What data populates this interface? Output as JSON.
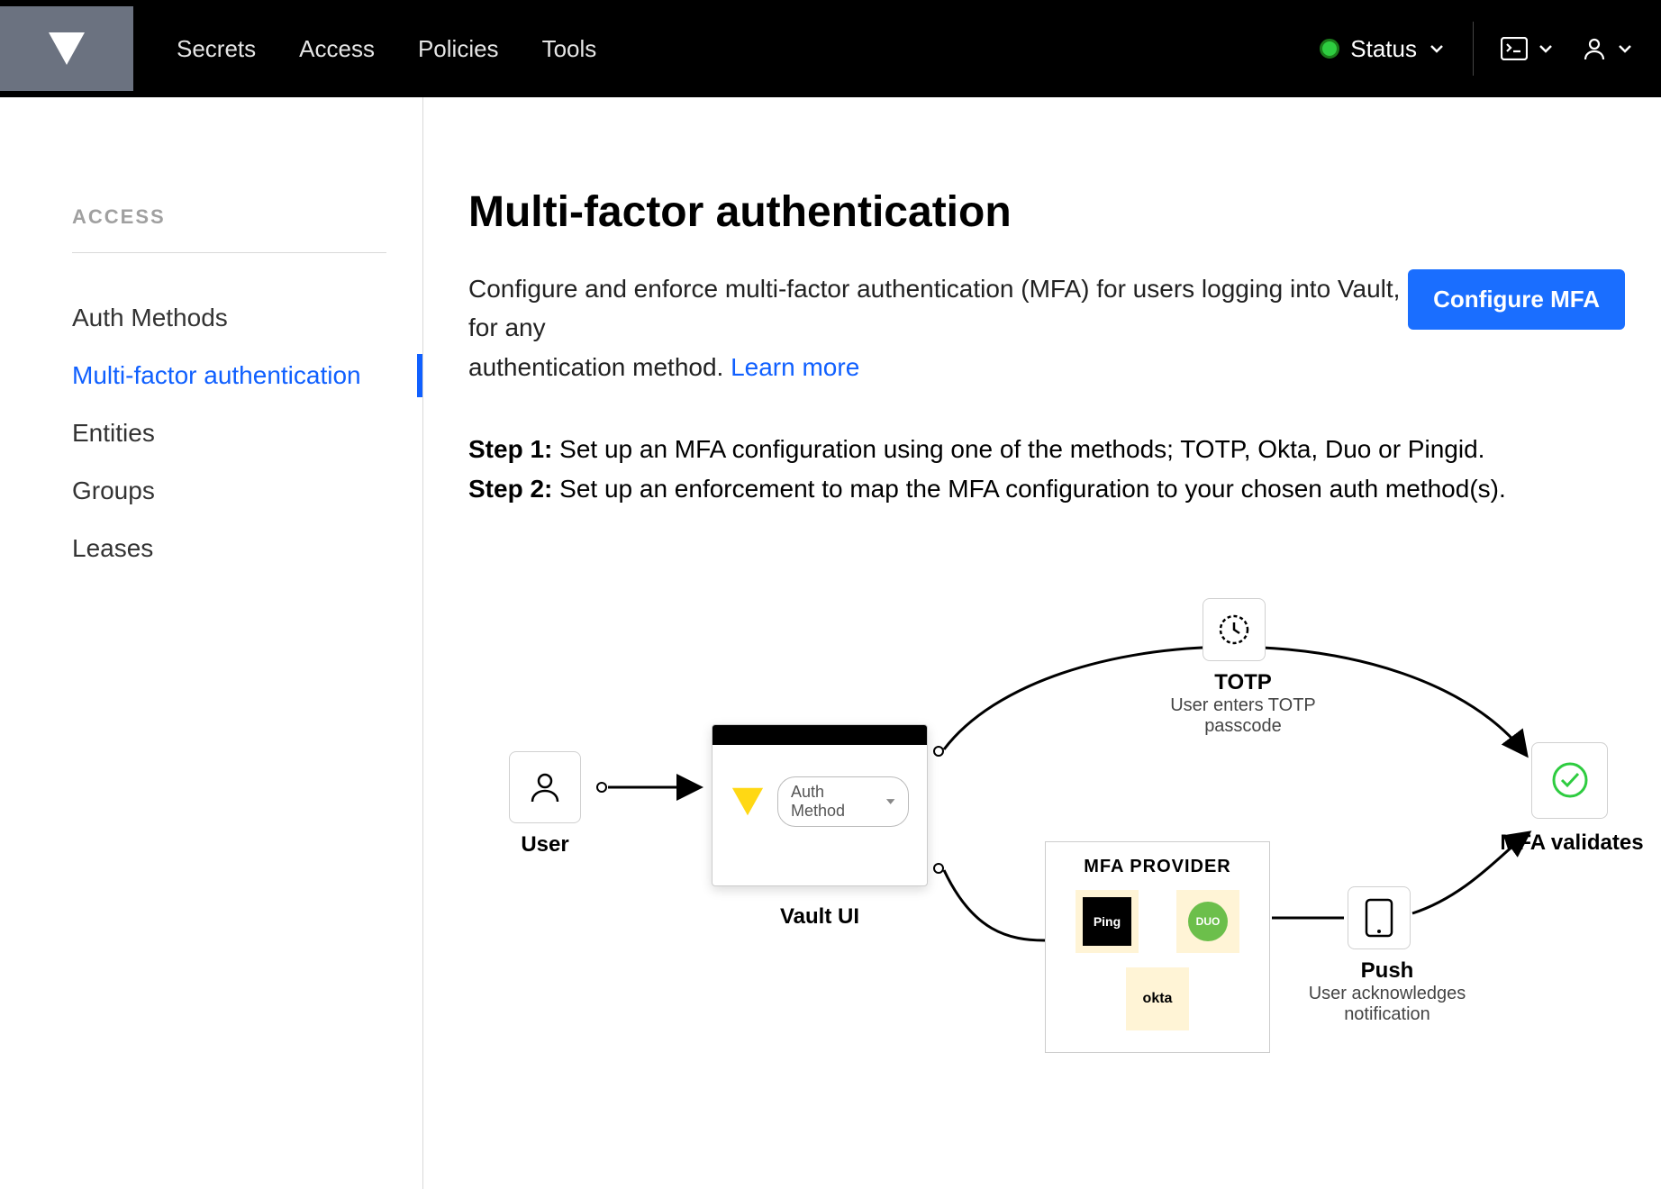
{
  "nav": {
    "items": [
      "Secrets",
      "Access",
      "Policies",
      "Tools"
    ]
  },
  "status": {
    "label": "Status"
  },
  "sidebar": {
    "title": "ACCESS",
    "items": [
      {
        "label": "Auth Methods",
        "active": false
      },
      {
        "label": "Multi-factor authentication",
        "active": true
      },
      {
        "label": "Entities",
        "active": false
      },
      {
        "label": "Groups",
        "active": false
      },
      {
        "label": "Leases",
        "active": false
      }
    ]
  },
  "page": {
    "title": "Multi-factor authentication",
    "description_lead": "Configure and enforce multi-factor authentication (MFA) for users logging into Vault, for any",
    "description_line2": "authentication method.",
    "learn_more": "Learn more",
    "configure_btn": "Configure MFA",
    "step1_label": "Step 1:",
    "step1_text": " Set up an MFA configuration using one of the methods; TOTP, Okta, Duo or Pingid.",
    "step2_label": "Step 2:",
    "step2_text": " Set up an enforcement to map the MFA configuration to your chosen auth method(s)."
  },
  "diagram": {
    "user": "User",
    "vault_ui": "Vault UI",
    "auth_method": "Auth Method",
    "totp": {
      "title": "TOTP",
      "sub": "User enters TOTP passcode"
    },
    "mfa_provider": "MFA PROVIDER",
    "providers": {
      "ping": "Ping",
      "duo": "DUO",
      "okta": "okta"
    },
    "push": {
      "title": "Push",
      "sub": "User acknowledges notification"
    },
    "validates": "MFA validates"
  }
}
